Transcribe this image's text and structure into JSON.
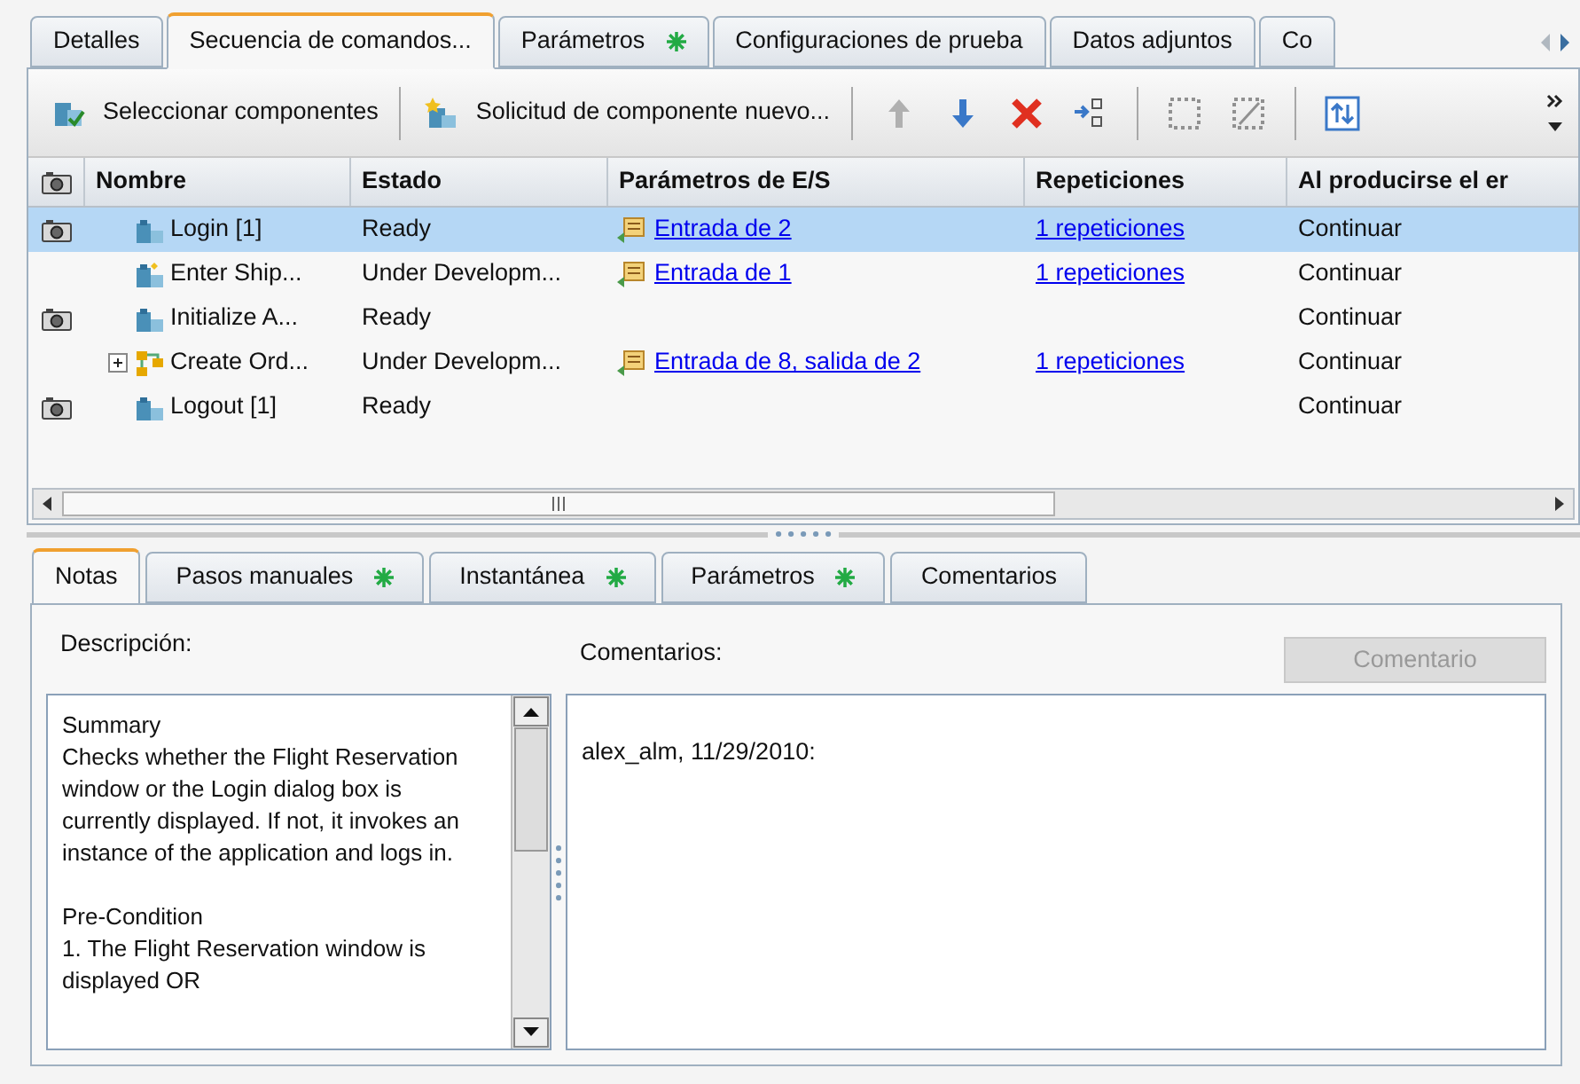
{
  "tabs": [
    {
      "label": "Detalles",
      "selected": false,
      "modified": false
    },
    {
      "label": "Secuencia  de  comandos...",
      "selected": true,
      "modified": false
    },
    {
      "label": "Parámetros",
      "selected": false,
      "modified": true
    },
    {
      "label": "Configuraciones de prueba",
      "selected": false,
      "modified": false
    },
    {
      "label": "Datos adjuntos",
      "selected": false,
      "modified": false
    },
    {
      "label": "Co",
      "selected": false,
      "modified": false
    }
  ],
  "toolbar": [
    {
      "kind": "select",
      "label": "Seleccionar componentes"
    },
    {
      "kind": "request",
      "label": "Solicitud de componente nuevo..."
    },
    {
      "kind": "up",
      "disabled": true
    },
    {
      "kind": "down",
      "disabled": false
    },
    {
      "kind": "delete",
      "disabled": false
    },
    {
      "kind": "group",
      "disabled": false
    },
    {
      "kind": "select-box",
      "disabled": true
    },
    {
      "kind": "deselect-box",
      "disabled": true
    },
    {
      "kind": "swap",
      "disabled": false
    }
  ],
  "table": {
    "columns": [
      "Nombre",
      "Estado",
      "Parámetros de E/S",
      "Repeticiones",
      "Al producirse el er"
    ],
    "rows": [
      {
        "selected": true,
        "snapshot": true,
        "expandable": false,
        "kind": "component",
        "name": "Login [1]",
        "status": "Ready",
        "params": "Entrada de 2",
        "repeats": "1 repeticiones",
        "on_error": "Continuar"
      },
      {
        "selected": false,
        "snapshot": false,
        "expandable": false,
        "kind": "component-new",
        "name": "Enter  Ship...",
        "status": "Under  Developm...",
        "params": "Entrada de 1",
        "repeats": "1 repeticiones",
        "on_error": "Continuar"
      },
      {
        "selected": false,
        "snapshot": true,
        "expandable": false,
        "kind": "component",
        "name": "Initialize  A...",
        "status": "Ready",
        "on_error": "Continuar"
      },
      {
        "selected": false,
        "snapshot": false,
        "expandable": true,
        "kind": "flow",
        "name": "Create  Ord...",
        "status": "Under  Developm...",
        "params": "Entrada de 8, salida de 2",
        "repeats": "1 repeticiones",
        "on_error": "Continuar"
      },
      {
        "selected": false,
        "snapshot": true,
        "expandable": false,
        "kind": "component",
        "name": "Logout [1]",
        "status": "Ready",
        "on_error": "Continuar"
      }
    ]
  },
  "bottom_tabs": [
    {
      "label": "Notas",
      "selected": true,
      "modified": false
    },
    {
      "label": "Pasos manuales",
      "selected": false,
      "modified": true
    },
    {
      "label": "Instantánea",
      "selected": false,
      "modified": true
    },
    {
      "label": "Parámetros",
      "selected": false,
      "modified": true
    },
    {
      "label": "Comentarios",
      "selected": false,
      "modified": false
    }
  ],
  "description": {
    "label": "Descripción:",
    "text": "Summary\nChecks whether the Flight Reservation window or the Login dialog box is currently displayed. If not, it invokes an instance of the application and logs in.\n\nPre-Condition\n1. The Flight Reservation window is displayed OR"
  },
  "comments": {
    "label": "Comentarios:",
    "button": {
      "label": "Comentario",
      "disabled": true
    },
    "text": "alex_alm, 11/29/2010:"
  }
}
